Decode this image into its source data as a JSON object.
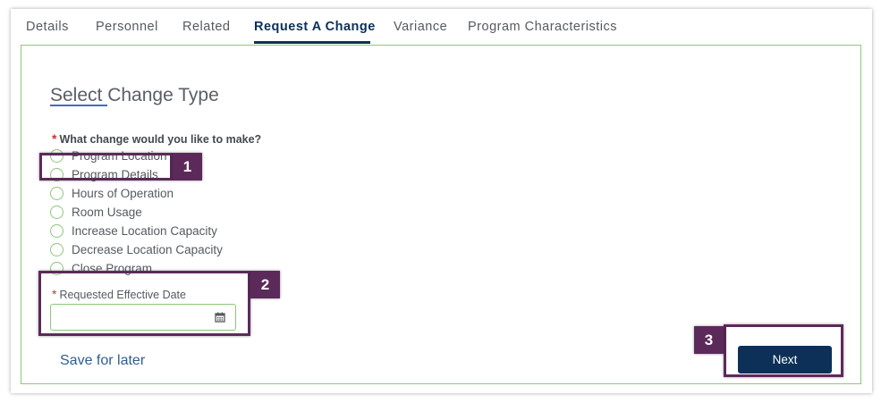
{
  "tabs": [
    {
      "label": "Details"
    },
    {
      "label": "Personnel"
    },
    {
      "label": "Related"
    },
    {
      "label": "Request A Change",
      "active": true
    },
    {
      "label": "Variance"
    },
    {
      "label": "Program Characteristics"
    }
  ],
  "form": {
    "title": "Select Change Type",
    "required_marker": "*",
    "question": "What change would you like to make?",
    "options": [
      {
        "label": "Program Location"
      },
      {
        "label": "Program Details"
      },
      {
        "label": "Hours of Operation"
      },
      {
        "label": "Room Usage"
      },
      {
        "label": "Increase Location Capacity"
      },
      {
        "label": "Decrease Location Capacity"
      },
      {
        "label": "Close Program"
      }
    ],
    "date_label": "Requested Effective Date",
    "date_value": "",
    "date_icon": "calendar-icon",
    "save_label": "Save for later",
    "next_label": "Next"
  },
  "callouts": [
    {
      "number": "1"
    },
    {
      "number": "2"
    },
    {
      "number": "3"
    }
  ],
  "colors": {
    "primary": "#0c3058",
    "accent_green": "#8dc77a",
    "callout": "#5c2a5a",
    "required": "#d0322f",
    "link": "#2e5e92"
  }
}
